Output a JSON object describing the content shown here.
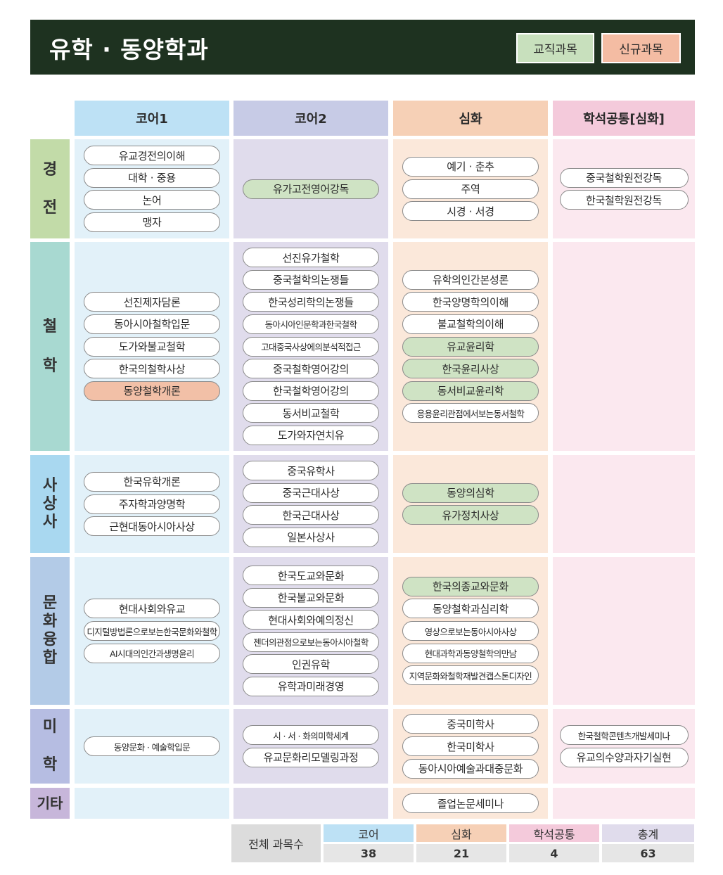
{
  "header": {
    "title": "유학 · 동양학과",
    "legend_green": "교직과목",
    "legend_pink": "신규과목"
  },
  "columns": [
    "코어1",
    "코어2",
    "심화",
    "학석공통[심화]"
  ],
  "colors": {
    "header_bg": "#1e3220",
    "col_bg": [
      "#e2f1f9",
      "#e0dcec",
      "#fbe8da",
      "#fbe8ef"
    ],
    "col_head": [
      "#bde1f5",
      "#c7cbe6",
      "#f6d0b6",
      "#f4cadb"
    ],
    "row_label": [
      "#c2dba8",
      "#a8d9d1",
      "#a9d8f0",
      "#b3cbe7",
      "#b6bde2",
      "#c7b6da"
    ]
  },
  "rows": [
    {
      "label": [
        "경",
        "전"
      ],
      "cells": [
        [
          {
            "t": "유교경전의이해"
          },
          {
            "t": "대학 · 중용"
          },
          {
            "t": "논어"
          },
          {
            "t": "맹자"
          }
        ],
        [
          {
            "t": "유가고전영어강독",
            "c": "green"
          }
        ],
        [
          {
            "t": "예기 · 춘추"
          },
          {
            "t": "주역"
          },
          {
            "t": "시경 · 서경"
          }
        ],
        [
          {
            "t": "중국철학원전강독"
          },
          {
            "t": "한국철학원전강독"
          }
        ]
      ]
    },
    {
      "label": [
        "철",
        "학"
      ],
      "cells": [
        [
          {
            "t": "선진제자담론"
          },
          {
            "t": "동아시아철학입문"
          },
          {
            "t": "도가와불교철학"
          },
          {
            "t": "한국의철학사상"
          },
          {
            "t": "동양철학개론",
            "c": "pink"
          }
        ],
        [
          {
            "t": "선진유가철학"
          },
          {
            "t": "중국철학의논쟁들"
          },
          {
            "t": "한국성리학의논쟁들"
          },
          {
            "t": "동아시아인문학과한국철학"
          },
          {
            "t": "고대중국사상에의분석적접근"
          },
          {
            "t": "중국철학영어강의"
          },
          {
            "t": "한국철학영어강의"
          },
          {
            "t": "동서비교철학"
          },
          {
            "t": "도가와자연치유"
          }
        ],
        [
          {
            "t": "유학의인간본성론"
          },
          {
            "t": "한국양명학의이해"
          },
          {
            "t": "불교철학의이해"
          },
          {
            "t": "유교윤리학",
            "c": "green"
          },
          {
            "t": "한국윤리사상",
            "c": "green"
          },
          {
            "t": "동서비교윤리학",
            "c": "green"
          },
          {
            "t": "응용윤리관점에서보는동서철학"
          }
        ],
        []
      ]
    },
    {
      "label": [
        "사",
        "상",
        "사"
      ],
      "cells": [
        [
          {
            "t": "한국유학개론"
          },
          {
            "t": "주자학과양명학"
          },
          {
            "t": "근현대동아시아사상"
          }
        ],
        [
          {
            "t": "중국유학사"
          },
          {
            "t": "중국근대사상"
          },
          {
            "t": "한국근대사상"
          },
          {
            "t": "일본사상사"
          }
        ],
        [
          {
            "t": "동양의심학",
            "c": "green"
          },
          {
            "t": "유가정치사상",
            "c": "green"
          }
        ],
        []
      ]
    },
    {
      "label": [
        "문",
        "화",
        "융",
        "합"
      ],
      "cells": [
        [
          {
            "t": "현대사회와유교"
          },
          {
            "t": "디지털방법론으로보는한국문화와철학"
          },
          {
            "t": "AI시대의인간과생명윤리"
          }
        ],
        [
          {
            "t": "한국도교와문화"
          },
          {
            "t": "한국불교와문화"
          },
          {
            "t": "현대사회와예의정신"
          },
          {
            "t": "젠더의관점으로보는동아시아철학"
          },
          {
            "t": "인권유학"
          },
          {
            "t": "유학과미래경영"
          }
        ],
        [
          {
            "t": "한국의종교와문화",
            "c": "green"
          },
          {
            "t": "동양철학과심리학"
          },
          {
            "t": "영상으로보는동아시아사상"
          },
          {
            "t": "현대과학과동양철학의만남"
          },
          {
            "t": "지역문화와철학재발견캡스톤디자인"
          }
        ],
        []
      ]
    },
    {
      "label": [
        "미",
        "학"
      ],
      "cells": [
        [
          {
            "t": "동양문화 · 예술학입문"
          }
        ],
        [
          {
            "t": "시 · 서 · 화의미학세계"
          },
          {
            "t": "유교문화리모델링과정"
          }
        ],
        [
          {
            "t": "중국미학사"
          },
          {
            "t": "한국미학사"
          },
          {
            "t": "동아시아예술과대중문화"
          }
        ],
        [
          {
            "t": "한국철학콘텐츠개발세미나"
          },
          {
            "t": "유교의수양과자기실현"
          }
        ]
      ]
    },
    {
      "label": [
        "기타"
      ],
      "cells": [
        [],
        [],
        [
          {
            "t": "졸업논문세미나"
          }
        ],
        []
      ]
    }
  ],
  "summary": {
    "label": "전체 과목수",
    "headers": [
      "코어",
      "심화",
      "학석공통",
      "총계"
    ],
    "values": [
      "38",
      "21",
      "4",
      "63"
    ],
    "head_colors": [
      "#bde1f5",
      "#f6d0b6",
      "#f4cadb",
      "#e0dcec"
    ]
  }
}
